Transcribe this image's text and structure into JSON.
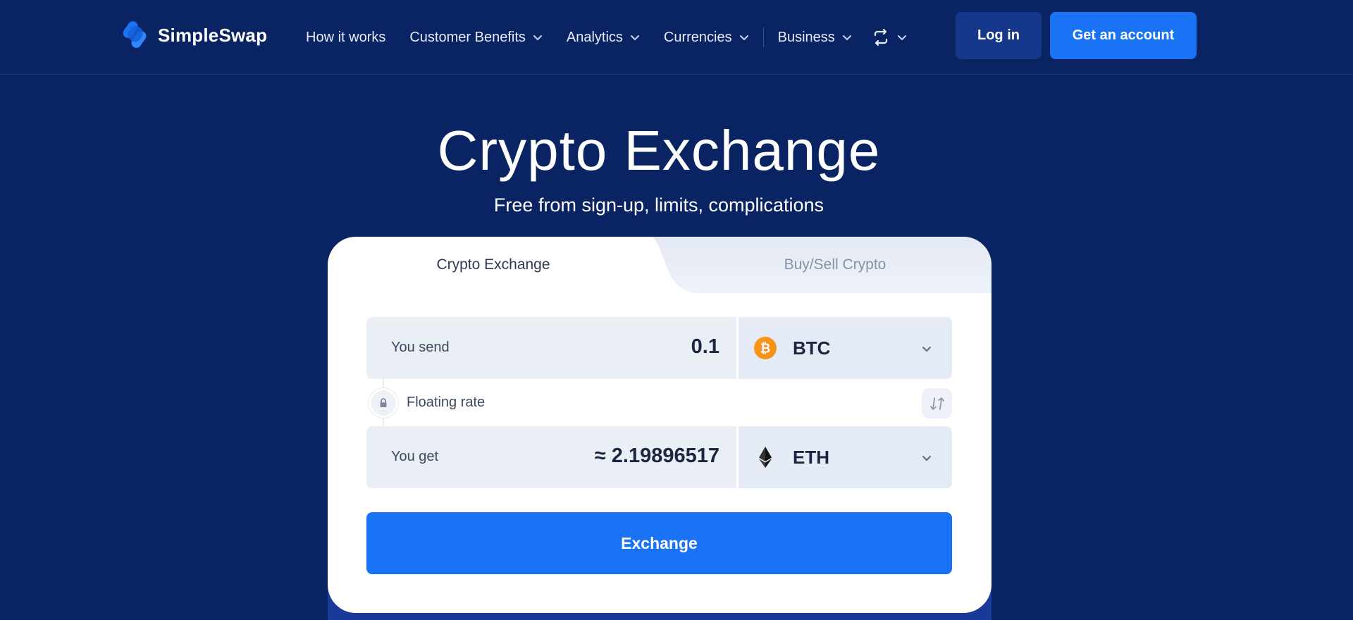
{
  "brand": {
    "name": "SimpleSwap",
    "colors": {
      "background": "#0a2463",
      "accent": "#1a73f5",
      "btc": "#f7931a"
    }
  },
  "nav": {
    "items": [
      {
        "label": "How it works",
        "has_dropdown": false
      },
      {
        "label": "Customer Benefits",
        "has_dropdown": true
      },
      {
        "label": "Analytics",
        "has_dropdown": true
      },
      {
        "label": "Currencies",
        "has_dropdown": true
      },
      {
        "label": "Business",
        "has_dropdown": true
      }
    ],
    "swap_icon": "swap-arrows-icon",
    "login_label": "Log in",
    "account_label": "Get an account"
  },
  "hero": {
    "title": "Crypto Exchange",
    "subtitle": "Free from sign-up, limits, complications"
  },
  "widget": {
    "tabs": [
      {
        "label": "Crypto Exchange",
        "active": true
      },
      {
        "label": "Buy/Sell Crypto",
        "active": false
      }
    ],
    "send": {
      "label": "You send",
      "amount": "0.1",
      "currency": "BTC",
      "icon": "bitcoin-icon"
    },
    "rate": {
      "label": "Floating rate",
      "icon": "lock-icon"
    },
    "get": {
      "label": "You get",
      "amount": "≈ 2.19896517",
      "currency": "ETH",
      "icon": "ethereum-icon"
    },
    "exchange_label": "Exchange"
  }
}
